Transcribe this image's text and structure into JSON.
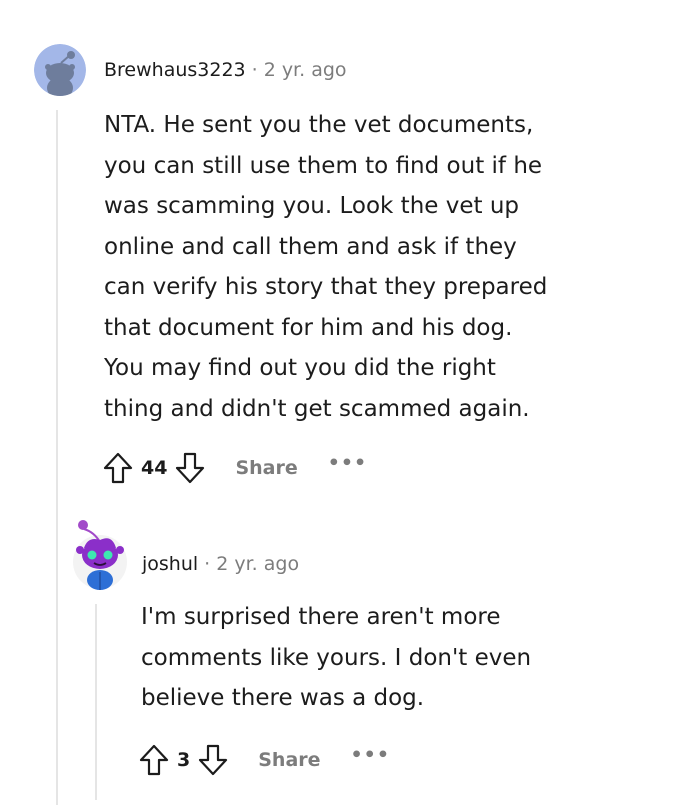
{
  "comments": [
    {
      "author": "Brewhaus3223",
      "separator": "·",
      "time": "2 yr. ago",
      "lines": [
        "NTA. He sent you the vet documents,",
        "you can still use them to find out if he",
        "was scamming you. Look the vet up",
        "online and call them and ask if they",
        "can verify his story that they prepared",
        "that document for him and his dog.",
        "You may find out you did the right",
        "thing and didn't get scammed again."
      ],
      "score": "44",
      "share_label": "Share",
      "more_label": "•••",
      "avatar_color": "#a3b7e8",
      "upvote_icon": "upvote-arrow-icon",
      "downvote_icon": "downvote-arrow-icon"
    },
    {
      "author": "joshul",
      "separator": "·",
      "time": "2 yr. ago",
      "lines": [
        "I'm surprised there aren't more",
        "comments like yours. I don't even",
        "believe there was a dog."
      ],
      "score": "3",
      "share_label": "Share",
      "more_label": "•••",
      "avatar_color": "#8b2fc9",
      "upvote_icon": "upvote-arrow-icon",
      "downvote_icon": "downvote-arrow-icon"
    }
  ],
  "colors": {
    "text": "#1c1c1c",
    "muted": "#7c7c7c",
    "thread_line": "#e5e5e5"
  }
}
